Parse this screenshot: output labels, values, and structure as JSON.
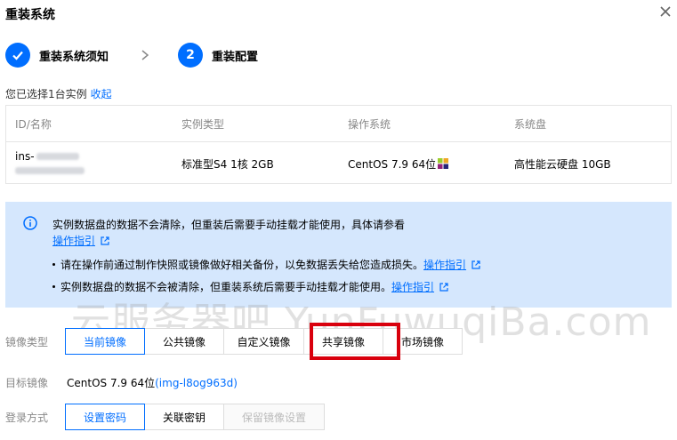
{
  "dialog": {
    "title": "重装系统"
  },
  "steps": [
    {
      "label": "重装系统须知",
      "done": true
    },
    {
      "number": "2",
      "label": "重装配置"
    }
  ],
  "selection": {
    "text": "您已选择1台实例",
    "toggle_label": "收起"
  },
  "instance_table": {
    "columns": [
      "ID/名称",
      "实例类型",
      "操作系统",
      "系统盘"
    ],
    "row": {
      "id_prefix": "ins-",
      "instance_type": "标准型S4 1核 2GB",
      "os": "CentOS 7.9 64位",
      "disk": "高性能云硬盘 10GB"
    }
  },
  "notice": {
    "main_text": "实例数据盘的数据不会清除，但重装后需要手动挂载才能使用，具体请参看",
    "main_link": "操作指引",
    "bullets": [
      {
        "text": "请在操作前通过制作快照或镜像做好相关备份，以免数据丢失给您造成损失。",
        "link": "操作指引"
      },
      {
        "text": "实例数据盘的数据不会被清除，但重装系统后需要手动挂载才能使用。",
        "link": "操作指引"
      }
    ]
  },
  "watermark": "云服务器吧,YunFuwuqiBa.com",
  "image_type": {
    "label": "镜像类型",
    "options": [
      "当前镜像",
      "公共镜像",
      "自定义镜像",
      "共享镜像",
      "市场镜像"
    ],
    "selected": "当前镜像",
    "highlighted": "共享镜像"
  },
  "target_image": {
    "label": "目标镜像",
    "name": "CentOS 7.9 64位",
    "id": "(img-l8og963d)"
  },
  "login_method": {
    "label": "登录方式",
    "options": [
      "设置密码",
      "关联密钥",
      "保留镜像设置"
    ],
    "selected": "设置密码",
    "disabled": "保留镜像设置"
  },
  "colors": {
    "primary": "#006eff",
    "notice_bg": "#d5e7fd",
    "highlight": "#d9000d"
  }
}
